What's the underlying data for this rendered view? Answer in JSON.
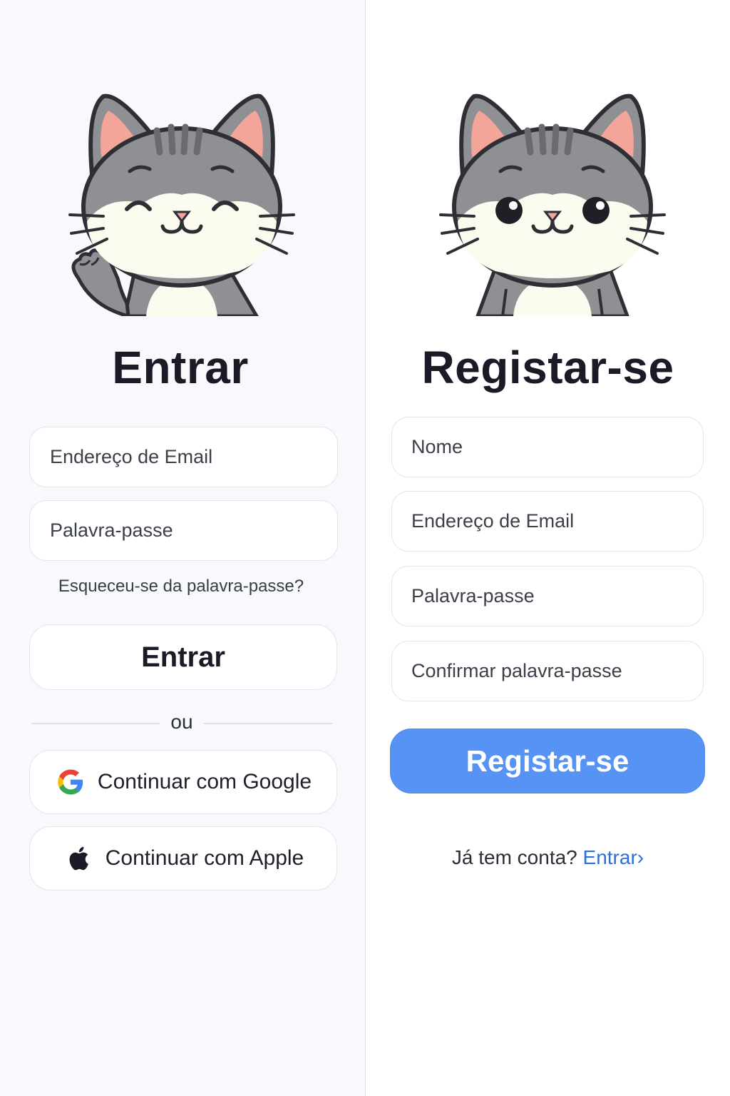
{
  "login": {
    "title": "Entrar",
    "email_placeholder": "Endereço de Email",
    "password_placeholder": "Palavra-passe",
    "forgot_password": "Esqueceu-se da palavra-passe?",
    "submit_label": "Entrar",
    "or_label": "ou",
    "google_label": "Continuar com Google",
    "apple_label": "Continuar com Apple"
  },
  "register": {
    "title": "Registar-se",
    "name_placeholder": "Nome",
    "email_placeholder": "Endereço de Email",
    "password_placeholder": "Palavra-passe",
    "confirm_password_placeholder": "Confirmar palavra-passe",
    "submit_label": "Registar-se",
    "have_account_text": "Já tem conta?",
    "login_link": "Entrar",
    "login_link_chevron": "›"
  },
  "icons": {
    "login_mascot": "waving-cat-icon",
    "register_mascot": "cat-icon",
    "google": "google-icon",
    "apple": "apple-icon"
  },
  "colors": {
    "accent": "#5693f5",
    "link": "#2f6fd8",
    "text": "#1a1b27"
  }
}
